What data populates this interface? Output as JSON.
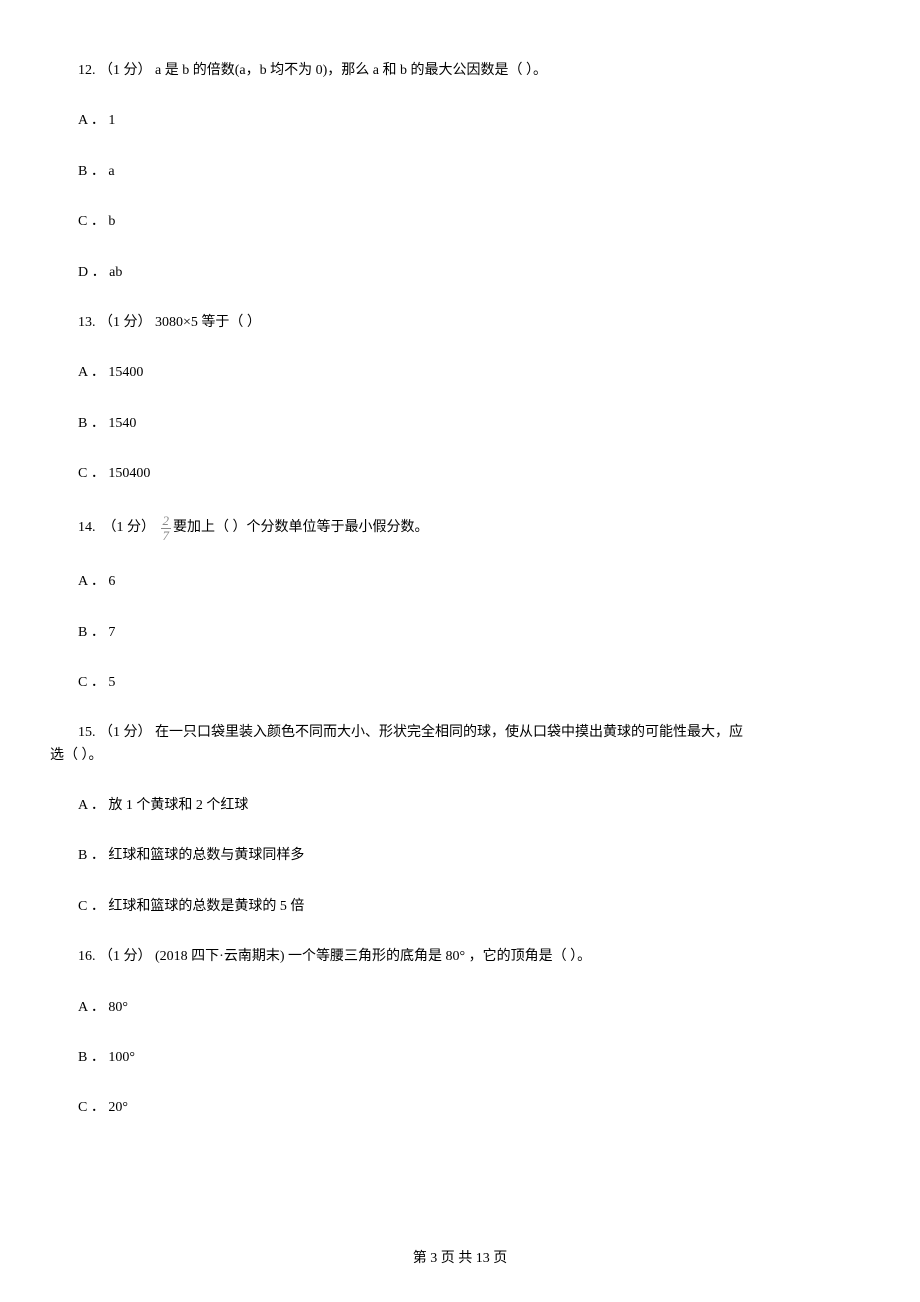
{
  "q12": {
    "text": "12.  （1 分）  a 是 b 的倍数(a，b 均不为 0)，那么 a 和 b 的最大公因数是（      ）。",
    "options": {
      "a": "A ．  1",
      "b": "B ．  a",
      "c": "C ．  b",
      "d": "D ．  ab"
    }
  },
  "q13": {
    "text": "13.  （1 分）  3080×5 等于（      ）",
    "options": {
      "a": "A ．  15400",
      "b": "B ．  1540",
      "c": "C ．  150400"
    }
  },
  "q14": {
    "pre": "14.  （1 分） ",
    "frac_num": "2",
    "frac_den": "7",
    "post": "  要加上（      ）个分数单位等于最小假分数。",
    "options": {
      "a": "A ．  6",
      "b": "B ．  7",
      "c": "C ．  5"
    }
  },
  "q15": {
    "line1": "15.  （1 分）  在一只口袋里装入颜色不同而大小、形状完全相同的球，使从口袋中摸出黄球的可能性最大，应",
    "line2": "选（      ）。",
    "options": {
      "a": "A ．  放 1 个黄球和 2 个红球",
      "b": "B ．  红球和篮球的总数与黄球同样多",
      "c": "C ．  红球和篮球的总数是黄球的 5 倍"
    }
  },
  "q16": {
    "text": "16.  （1 分）  (2018 四下·云南期末)  一个等腰三角形的底角是 80° ，它的顶角是（      ）。",
    "options": {
      "a": "A ．  80°",
      "b": "B ．  100°",
      "c": "C ．  20°"
    }
  },
  "footer": "第  3  页  共  13  页"
}
